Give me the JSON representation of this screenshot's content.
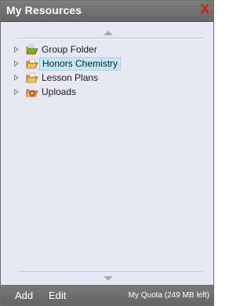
{
  "window": {
    "title": "My Resources",
    "close_label": "X",
    "close_color": "#e4120b"
  },
  "tree": {
    "items": [
      {
        "label": "Group Folder",
        "icon": "group-folder-icon",
        "selected": false,
        "state": "collapsed"
      },
      {
        "label": "Honors Chemistry",
        "icon": "folder-icon",
        "selected": true,
        "state": "collapsed"
      },
      {
        "label": "Lesson Plans",
        "icon": "folder-icon",
        "selected": false,
        "state": "collapsed"
      },
      {
        "label": "Uploads",
        "icon": "uploads-folder-icon",
        "selected": false,
        "state": "collapsed"
      }
    ],
    "selected_highlight_color": "#bfe9fb"
  },
  "footer": {
    "add_label": "Add",
    "edit_label": "Edit",
    "quota_text": "My Quota (249 MB left)"
  }
}
